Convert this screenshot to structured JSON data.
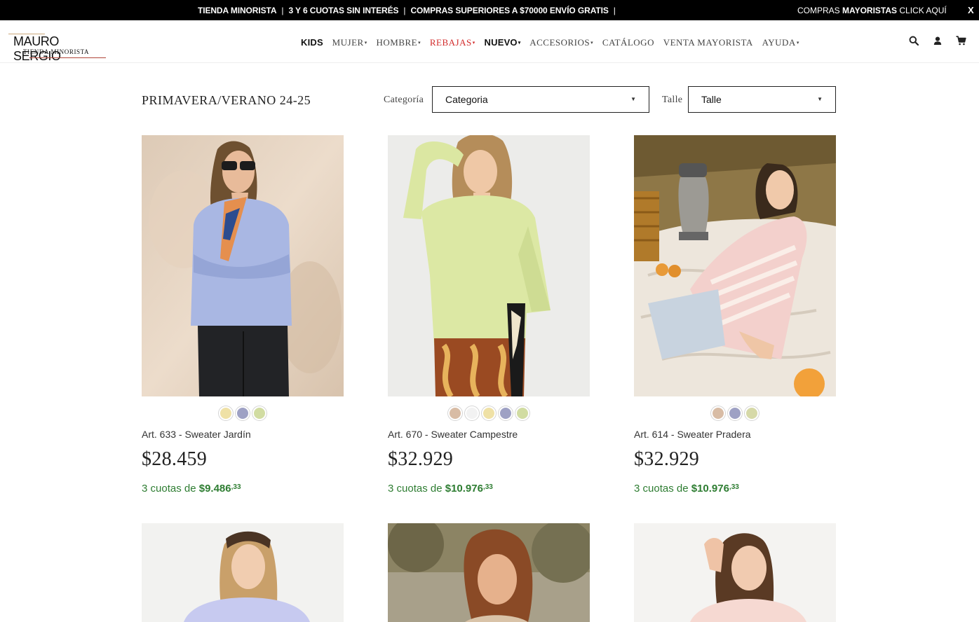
{
  "topbar": {
    "promos": [
      "TIENDA MINORISTA",
      "3 Y 6 CUOTAS SIN INTERÉS",
      "COMPRAS SUPERIORES A $70000 ENVÍO GRATIS"
    ],
    "separator": "|",
    "wholesale_prefix": "COMPRAS ",
    "wholesale_bold": "MAYORISTAS",
    "wholesale_suffix": " CLICK AQUÍ",
    "close": "X"
  },
  "brand": {
    "name": "MAURO SERGIO",
    "tagline": "TIENDA MINORISTA"
  },
  "nav": {
    "items": [
      {
        "label": "KIDS"
      },
      {
        "label": "MUJER"
      },
      {
        "label": "HOMBRE"
      },
      {
        "label": "REBAJAS"
      },
      {
        "label": "NUEVO"
      },
      {
        "label": "ACCESORIOS"
      },
      {
        "label": "CATÁLOGO"
      },
      {
        "label": "VENTA MAYORISTA"
      },
      {
        "label": "AYUDA"
      }
    ],
    "caret": "▾"
  },
  "header_icons": [
    "search-icon",
    "user-icon",
    "cart-icon"
  ],
  "listing": {
    "title": "PRIMAVERA/VERANO 24-25",
    "category_label": "Categoría",
    "category_value": "Categoria",
    "size_label": "Talle",
    "size_value": "Talle",
    "select_arrow": "▼"
  },
  "products": [
    {
      "name": "Art. 633 - Sweater Jardín",
      "price": "$28.459",
      "installments_prefix": "3 cuotas de ",
      "installment_amount": "$9.486",
      "installment_cents": ",33",
      "swatches": [
        "#efe1a6",
        "#9ea1c4",
        "#d1dca2"
      ]
    },
    {
      "name": "Art. 670 - Sweater Campestre",
      "price": "$32.929",
      "installments_prefix": "3 cuotas de ",
      "installment_amount": "$10.976",
      "installment_cents": ",33",
      "swatches": [
        "#d8bca5",
        "#f2f2f2",
        "#efe1a6",
        "#9ea1c4",
        "#d1dca2"
      ]
    },
    {
      "name": "Art. 614 - Sweater Pradera",
      "price": "$32.929",
      "installments_prefix": "3 cuotas de ",
      "installment_amount": "$10.976",
      "installment_cents": ",33",
      "swatches": [
        "#d8bca5",
        "#9ea1c4",
        "#d6d9a8"
      ]
    }
  ],
  "colors": {
    "topbar_bg": "#000000",
    "sale": "#d22a2a",
    "installments": "#2e7d32"
  }
}
